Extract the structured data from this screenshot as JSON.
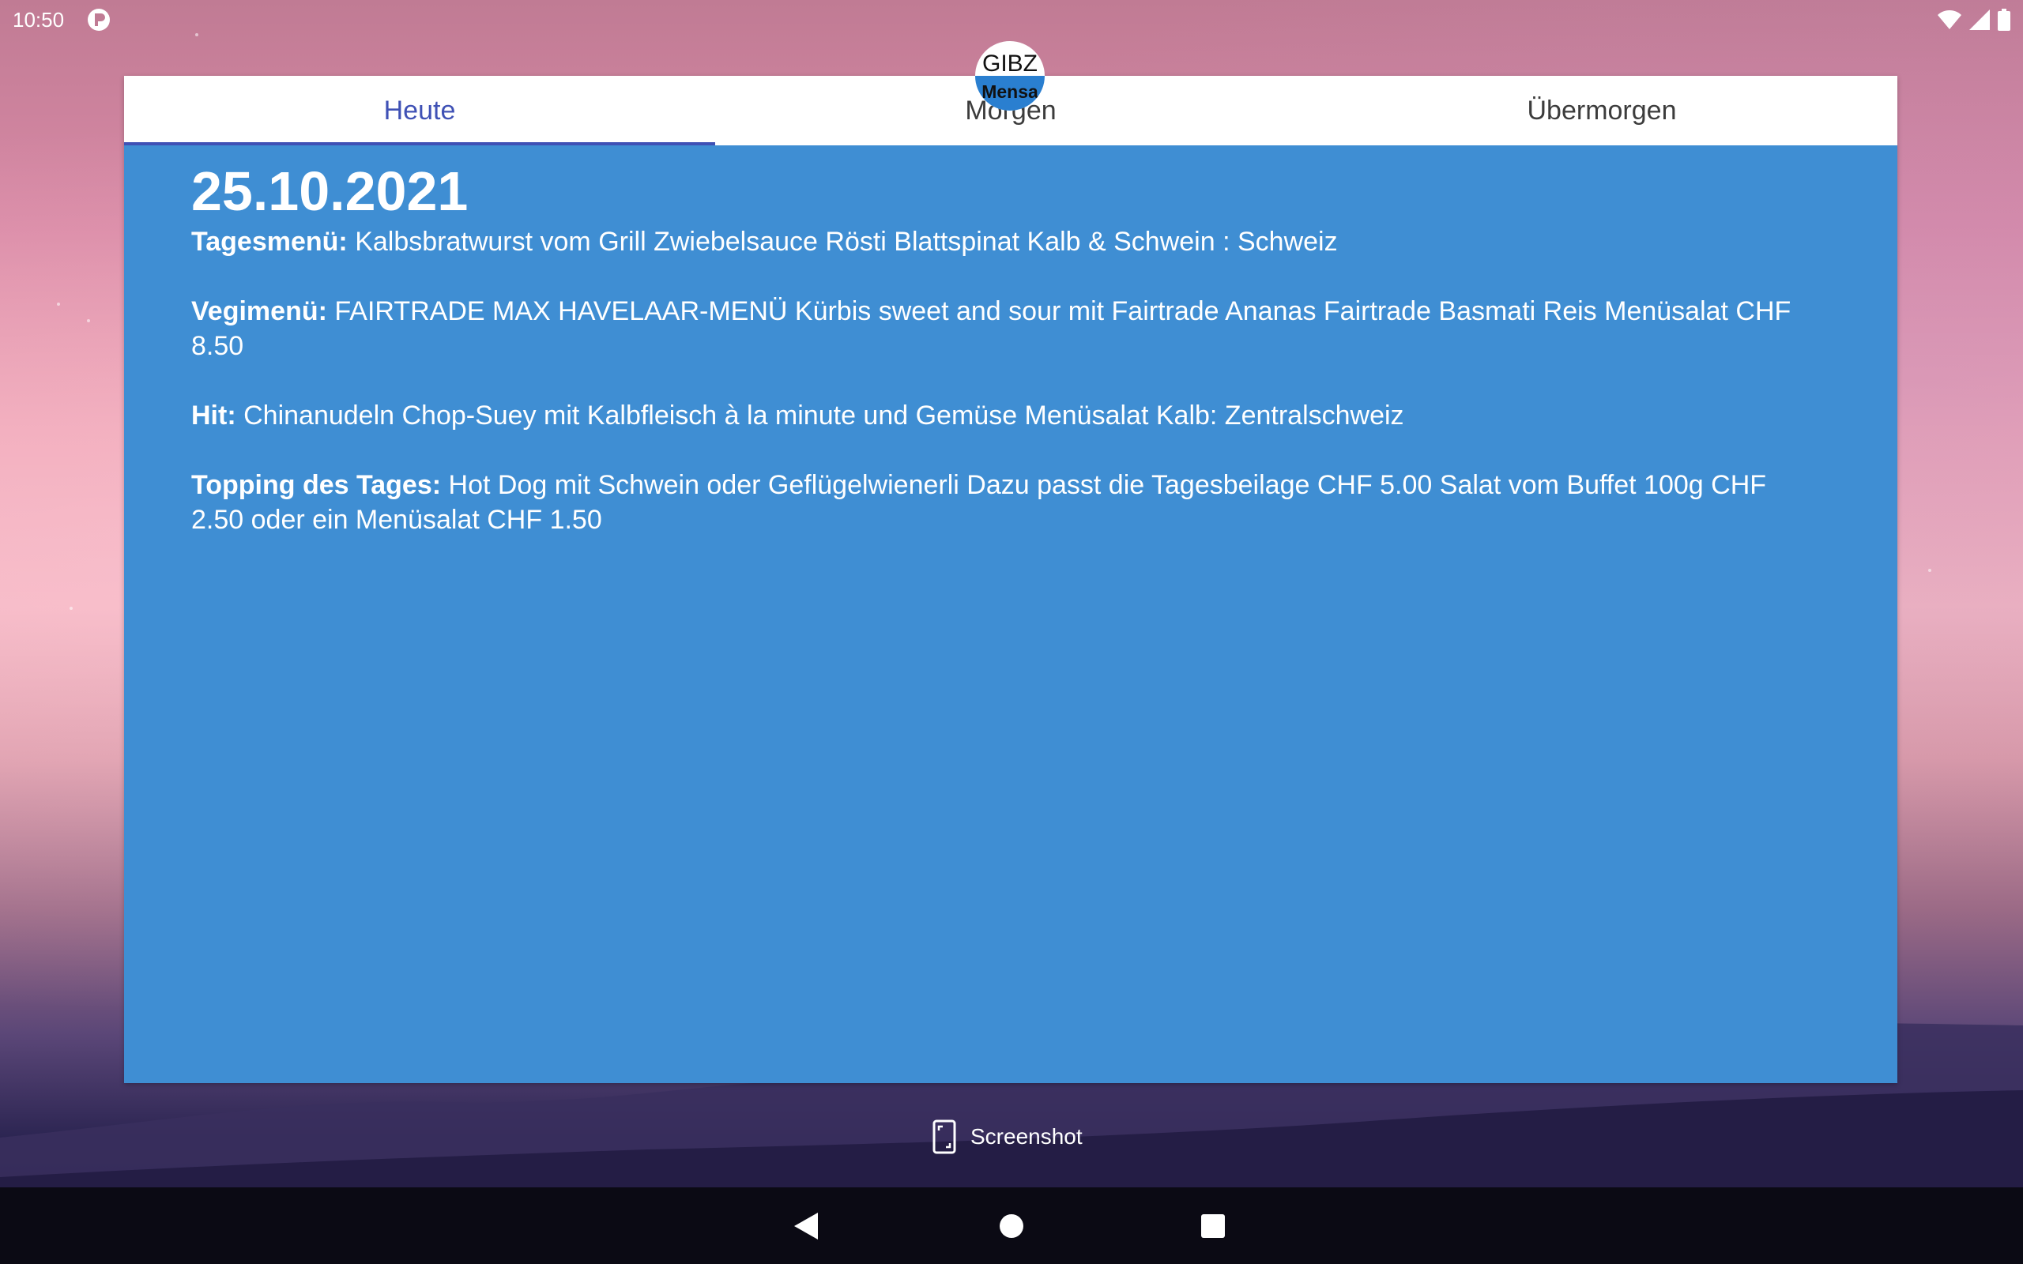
{
  "status_bar": {
    "time": "10:50",
    "icons": [
      "app-notification-icon",
      "wifi-icon",
      "signal-icon",
      "battery-icon"
    ]
  },
  "app": {
    "logo": {
      "line1": "GIBZ",
      "line2": "Mensa"
    },
    "tabs": [
      {
        "label": "Heute",
        "active": true
      },
      {
        "label": "Morgen",
        "active": false
      },
      {
        "label": "Übermorgen",
        "active": false
      }
    ],
    "date": "25.10.2021",
    "menus": [
      {
        "label": "Tagesmenü:",
        "text": " Kalbsbratwurst vom Grill Zwiebelsauce Rösti Blattspinat Kalb & Schwein : Schweiz"
      },
      {
        "label": "Vegimenü:",
        "text": " FAIRTRADE MAX HAVELAAR-MENÜ Kürbis sweet and sour mit Fairtrade Ananas Fairtrade Basmati Reis Menüsalat CHF 8.50"
      },
      {
        "label": "Hit:",
        "text": " Chinanudeln Chop-Suey mit Kalbfleisch à la minute und Gemüse Menüsalat Kalb: Zentralschweiz"
      },
      {
        "label": "Topping des Tages:",
        "text": " Hot Dog mit Schwein oder Geflügelwienerli Dazu passt die Tagesbeilage CHF 5.00 Salat vom Buffet 100g CHF 2.50 oder ein Menüsalat CHF 1.50"
      }
    ],
    "colors": {
      "content_background": "#3f8ed3",
      "tab_active": "#3f51b5",
      "tab_inactive": "#3c3c3c"
    }
  },
  "screenshot_chip": {
    "label": "Screenshot"
  },
  "nav_bar": {
    "buttons": [
      "back-icon",
      "home-icon",
      "recents-icon"
    ]
  }
}
